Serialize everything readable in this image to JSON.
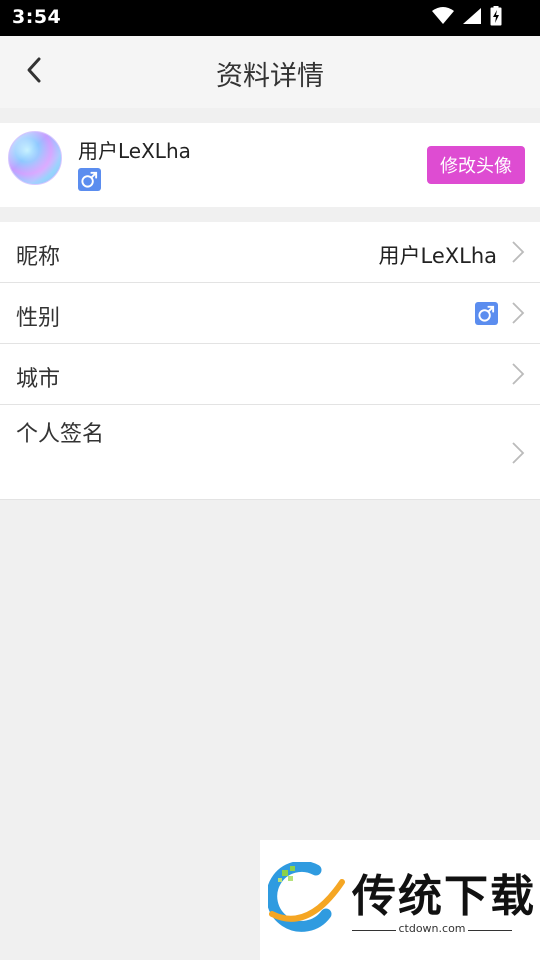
{
  "status_bar": {
    "time": "3:54",
    "icons": [
      "wifi-icon",
      "cellular-signal-icon",
      "battery-charging-icon"
    ]
  },
  "header": {
    "title": "资料详情",
    "back_icon": "chevron-left-icon"
  },
  "profile": {
    "name": "用户LeXLha",
    "gender_symbol": "♂",
    "edit_avatar_label": "修改头像"
  },
  "rows": [
    {
      "label": "昵称",
      "value": "用户LeXLha"
    },
    {
      "label": "性别",
      "value": "♂"
    },
    {
      "label": "城市",
      "value": ""
    },
    {
      "label": "个人签名",
      "value": ""
    }
  ],
  "watermark": {
    "brand": "传统下载",
    "domain": "ctdown.com"
  },
  "colors": {
    "accent_button": "#de4cd2",
    "gender_badge": "#5b8def",
    "background": "#f0f0f0"
  }
}
